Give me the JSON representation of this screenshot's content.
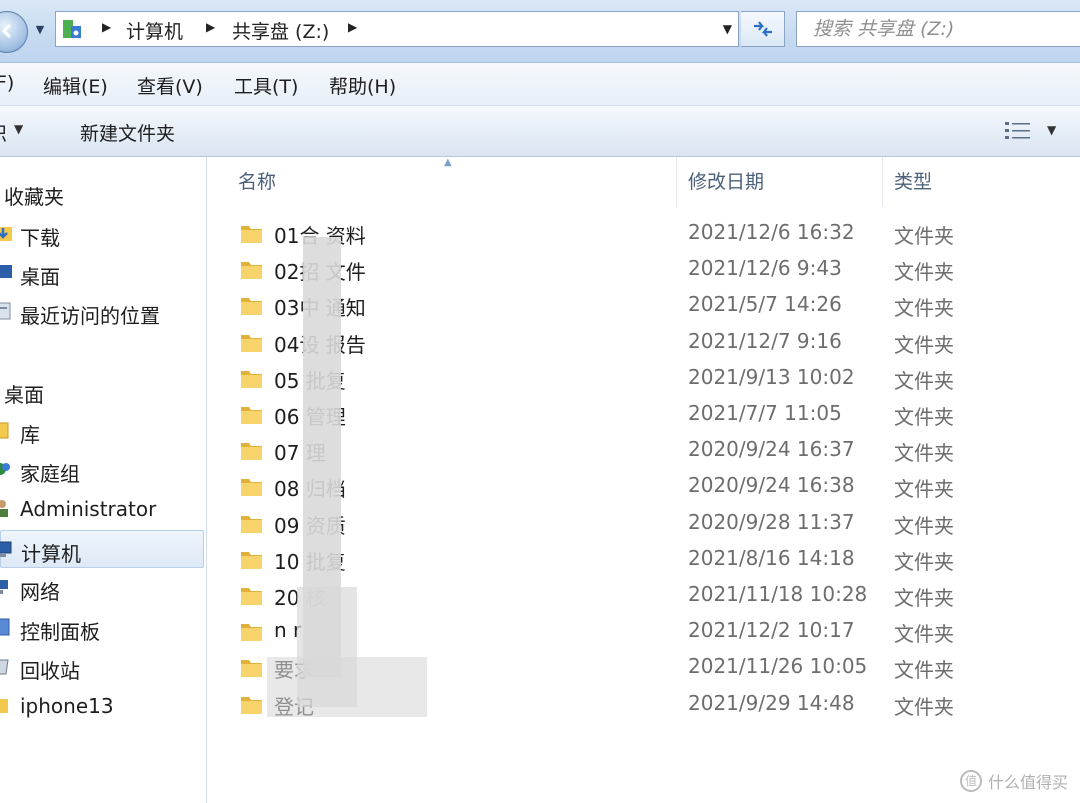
{
  "titlebar": {
    "breadcrumbs": [
      "计算机",
      "共享盘 (Z:)"
    ],
    "search_placeholder": "搜索 共享盘 (Z:)"
  },
  "menu": {
    "items": [
      "F)",
      "编辑(E)",
      "查看(V)",
      "工具(T)",
      "帮助(H)"
    ]
  },
  "commandbar": {
    "organize_label": "织",
    "new_folder_label": "新建文件夹"
  },
  "navpane": {
    "favorites_label": "收藏夹",
    "favorites": [
      "下载",
      "桌面",
      "最近访问的位置"
    ],
    "desktop_label": "桌面",
    "desktop_items": [
      "库",
      "家庭组",
      "Administrator",
      "计算机",
      "网络",
      "控制面板",
      "回收站",
      "iphone13"
    ],
    "selected": "计算机"
  },
  "columns": {
    "name": "名称",
    "modified": "修改日期",
    "type": "类型"
  },
  "files": [
    {
      "name": "01合    资料",
      "date": "2021/12/6 16:32",
      "type": "文件夹"
    },
    {
      "name": "02招    文件",
      "date": "2021/12/6 9:43",
      "type": "文件夹"
    },
    {
      "name": "03中    通知",
      "date": "2021/5/7 14:26",
      "type": "文件夹"
    },
    {
      "name": "04设    报告",
      "date": "2021/12/7 9:16",
      "type": "文件夹"
    },
    {
      "name": "05      批复",
      "date": "2021/9/13 10:02",
      "type": "文件夹"
    },
    {
      "name": "06      管理",
      "date": "2021/7/7 11:05",
      "type": "文件夹"
    },
    {
      "name": "07      理",
      "date": "2020/9/24 16:37",
      "type": "文件夹"
    },
    {
      "name": "08      归档",
      "date": "2020/9/24 16:38",
      "type": "文件夹"
    },
    {
      "name": "09      资质",
      "date": "2020/9/28 11:37",
      "type": "文件夹"
    },
    {
      "name": "10      批复",
      "date": "2021/8/16 14:18",
      "type": "文件夹"
    },
    {
      "name": "20      核",
      "date": "2021/11/18 10:28",
      "type": "文件夹"
    },
    {
      "name": "n      r",
      "date": "2021/12/2 10:17",
      "type": "文件夹"
    },
    {
      "name": "                要求",
      "date": "2021/11/26 10:05",
      "type": "文件夹"
    },
    {
      "name": "                登记",
      "date": "2021/9/29 14:48",
      "type": "文件夹"
    }
  ],
  "watermark": {
    "glyph": "值",
    "text": "什么值得买"
  },
  "colors": {
    "folder": "#f2c94c",
    "selection": "#dde9f6",
    "header_text": "#4c607a"
  }
}
